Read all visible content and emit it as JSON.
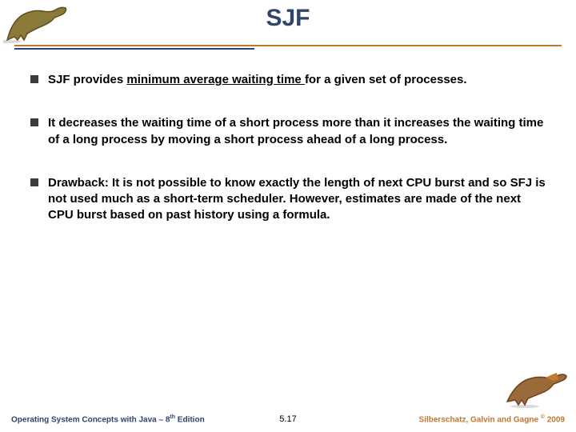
{
  "title": "SJF",
  "bullets": [
    {
      "pre": "SJF provides ",
      "underlined": "minimum average waiting time ",
      "post": "for a given set of processes."
    },
    {
      "pre": "It decreases the waiting time of a short process more than it increases the waiting time of a long process by moving a short process ahead of a long process.",
      "underlined": "",
      "post": ""
    },
    {
      "pre": "Drawback: It is not possible to know exactly the length of next CPU burst and so SFJ is not used much as a short-term scheduler. However, estimates are made of the next CPU burst based on past history using a formula.",
      "underlined": "",
      "post": ""
    }
  ],
  "footer": {
    "left_a": "Operating System Concepts with Java – 8",
    "left_sup": "th",
    "left_b": " Edition",
    "center": "5.17",
    "right_a": "Silberschatz, Galvin and Gagne ",
    "right_sup": "©",
    "right_b": " 2009"
  }
}
